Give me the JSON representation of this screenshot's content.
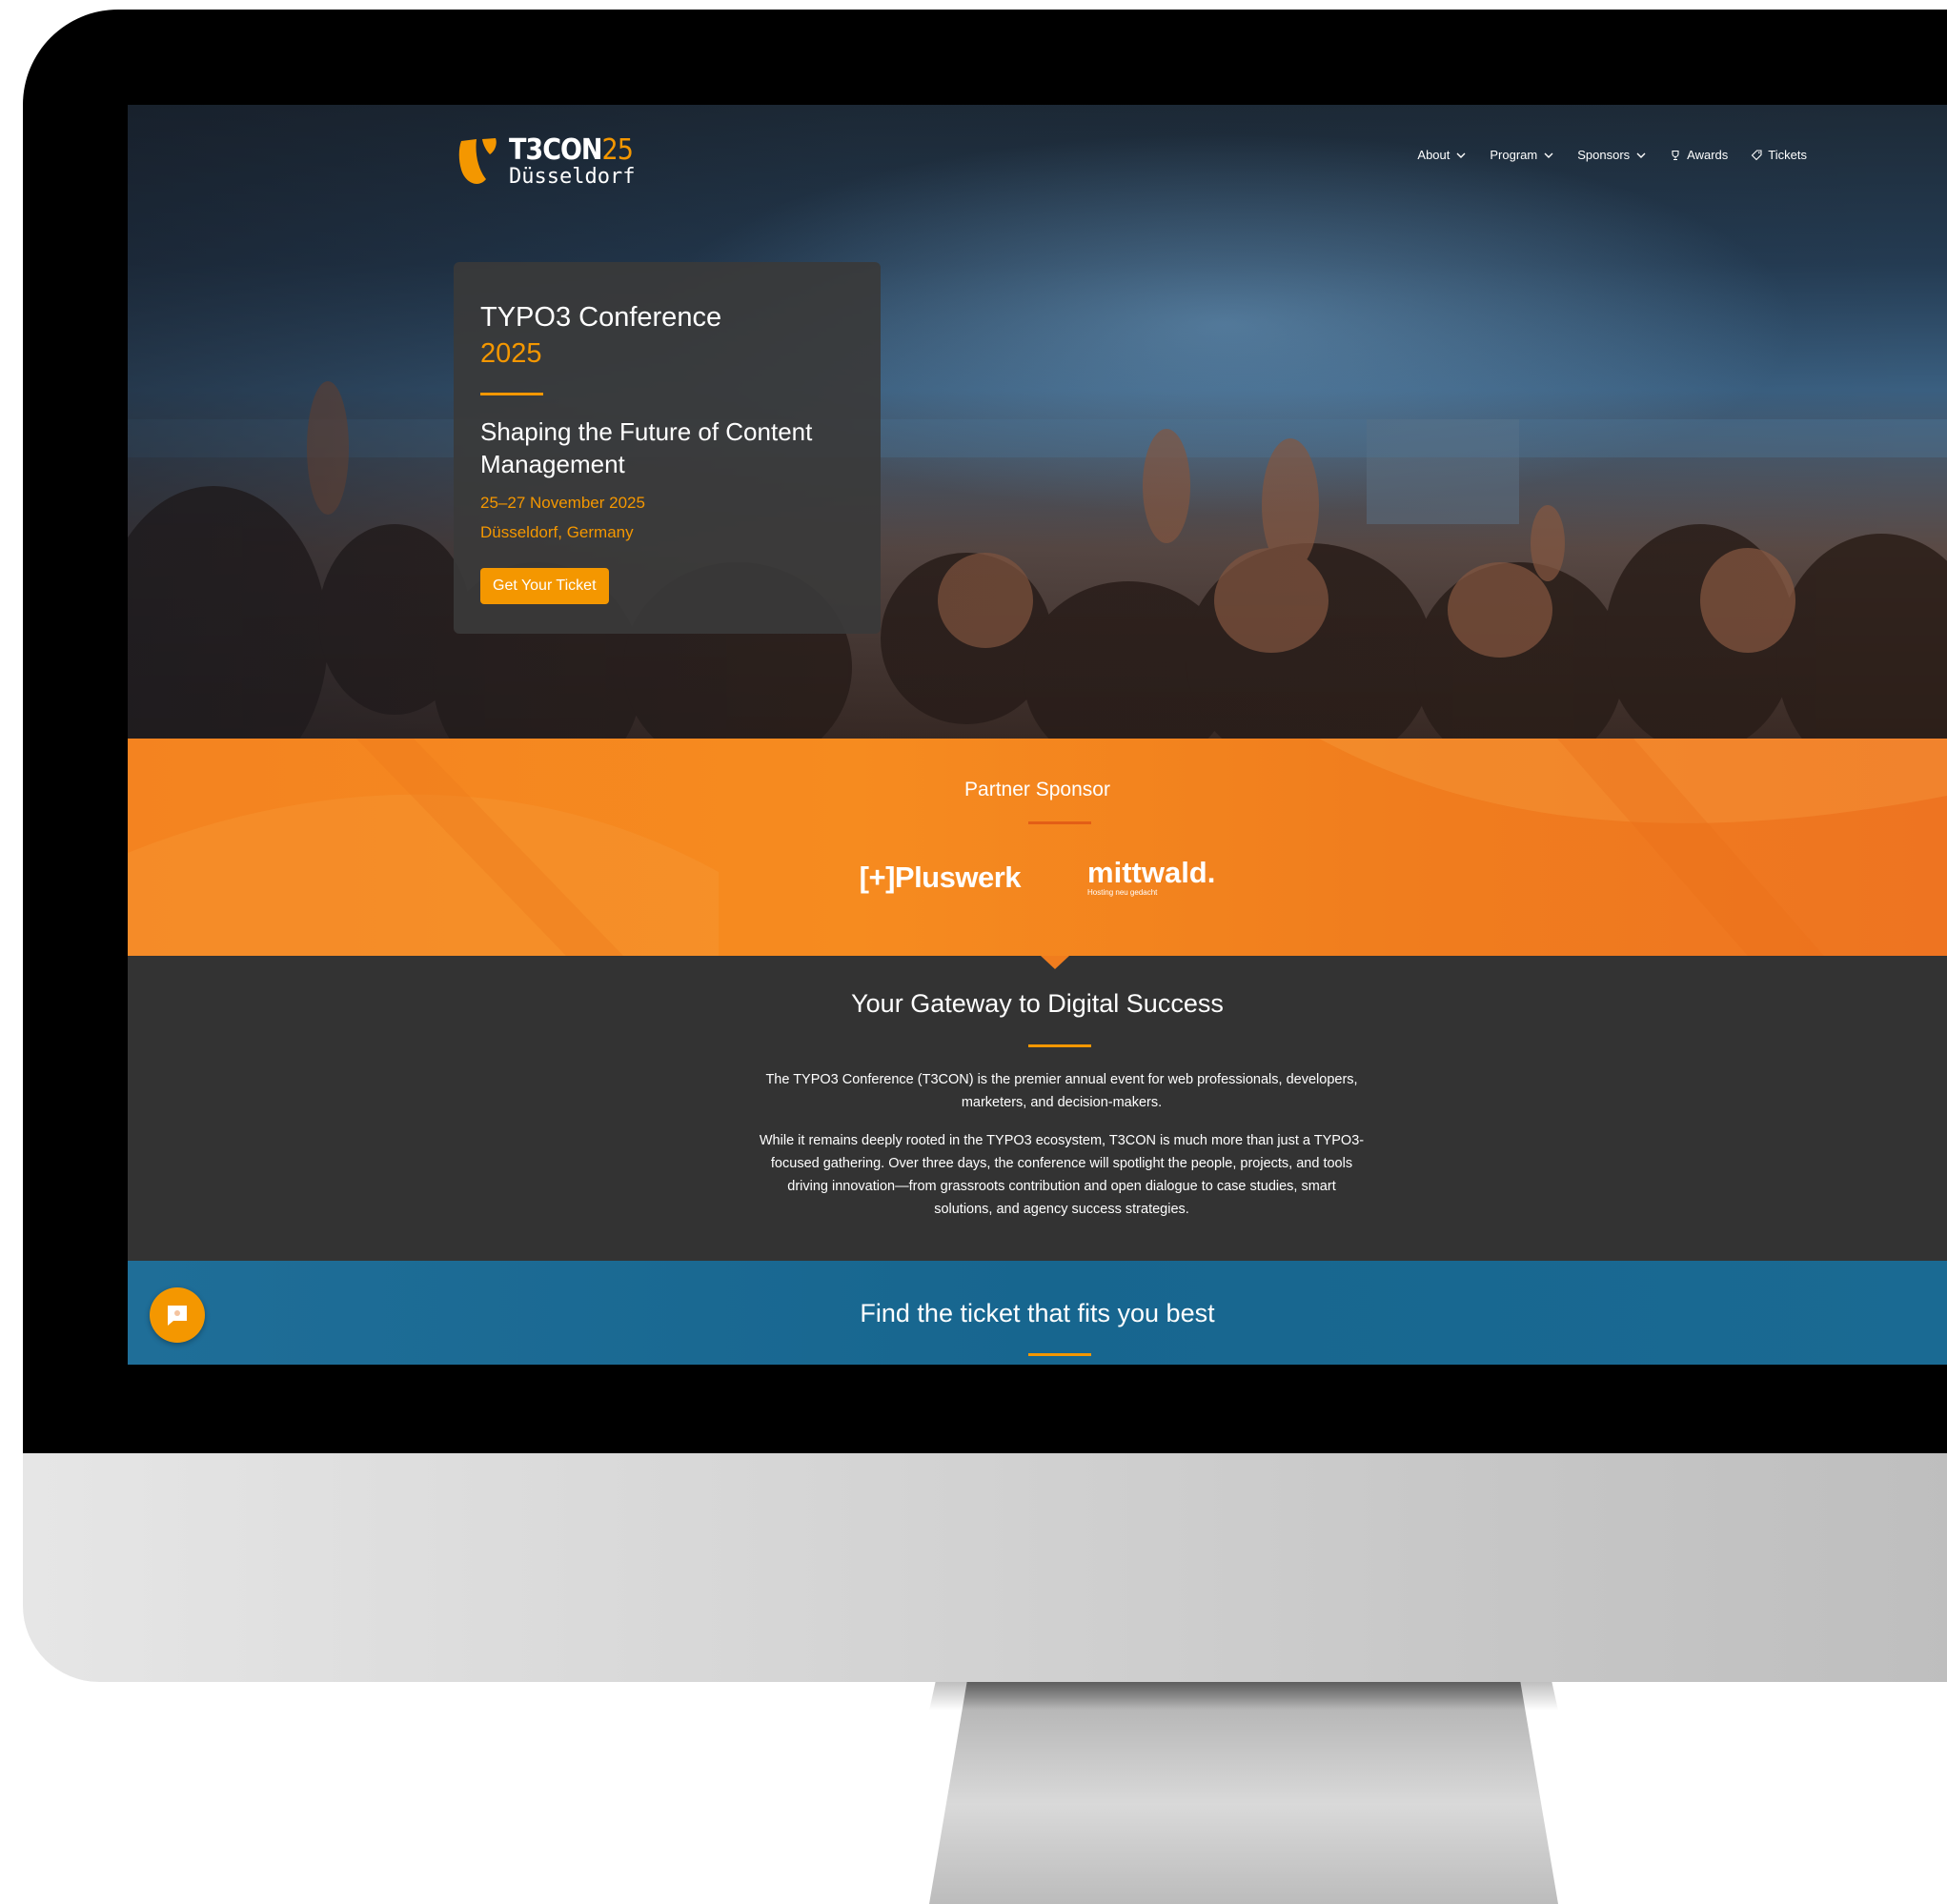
{
  "header": {
    "logo": {
      "brand": "T3CON",
      "brand_year": "25",
      "city": "Düsseldorf"
    },
    "nav": [
      {
        "label": "About",
        "icon": "chevron-down-icon"
      },
      {
        "label": "Program",
        "icon": "chevron-down-icon"
      },
      {
        "label": "Sponsors",
        "icon": "chevron-down-icon"
      },
      {
        "label": "Awards",
        "icon": "trophy-icon"
      },
      {
        "label": "Tickets",
        "icon": "ticket-icon"
      }
    ]
  },
  "hero": {
    "title": "TYPO3 Conference",
    "year": "2025",
    "subtitle": "Shaping the Future of Content Management",
    "date": "25–27 November 2025",
    "location": "Düsseldorf, Germany",
    "cta_label": "Get Your Ticket"
  },
  "sponsors": {
    "title": "Partner Sponsor",
    "logos": [
      {
        "name": "[+]Pluswerk"
      },
      {
        "name": "mittwald.",
        "tagline": "Hosting neu gedacht"
      }
    ]
  },
  "intro": {
    "title": "Your Gateway to Digital Success",
    "paragraph_1": "The TYPO3 Conference (T3CON) is the premier annual event for web professionals, developers, marketers, and decision-makers.",
    "paragraph_2": "While it remains deeply rooted in the TYPO3 ecosystem, T3CON is much more than just a TYPO3-focused gathering. Over three days, the conference will spotlight the people, projects, and tools driving innovation—from grassroots contribution and open dialogue to case studies, smart solutions, and agency success strategies."
  },
  "tickets": {
    "title": "Find the ticket that fits you best"
  },
  "chat": {
    "icon": "chat-icon"
  },
  "colors": {
    "accent": "#f49700",
    "sponsor_band": "#f68b1f",
    "dark_section": "#333333",
    "tickets_band": "#17668f"
  }
}
